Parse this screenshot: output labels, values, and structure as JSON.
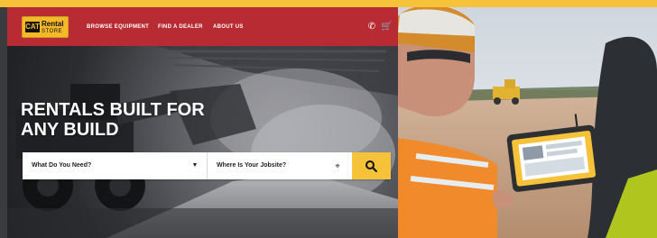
{
  "brand": {
    "cat": "CAT",
    "rental": "Rental",
    "store": "STORE"
  },
  "nav": {
    "browse": "BROWSE EQUIPMENT",
    "dealer": "FIND A DEALER",
    "about": "ABOUT US"
  },
  "hero": {
    "title_line1": "RENTALS BUILT FOR",
    "title_line2": "ANY BUILD"
  },
  "search": {
    "need": "What Do You Need?",
    "jobsite": "Where Is Your Jobsite?"
  },
  "icons": {
    "phone": "phone-icon",
    "cart": "cart-icon",
    "caret": "chevron-down-icon",
    "pin": "location-pin-icon",
    "search": "search-icon"
  },
  "colors": {
    "nav_red": "#b92b32",
    "accent_yellow": "#f6c23a"
  }
}
